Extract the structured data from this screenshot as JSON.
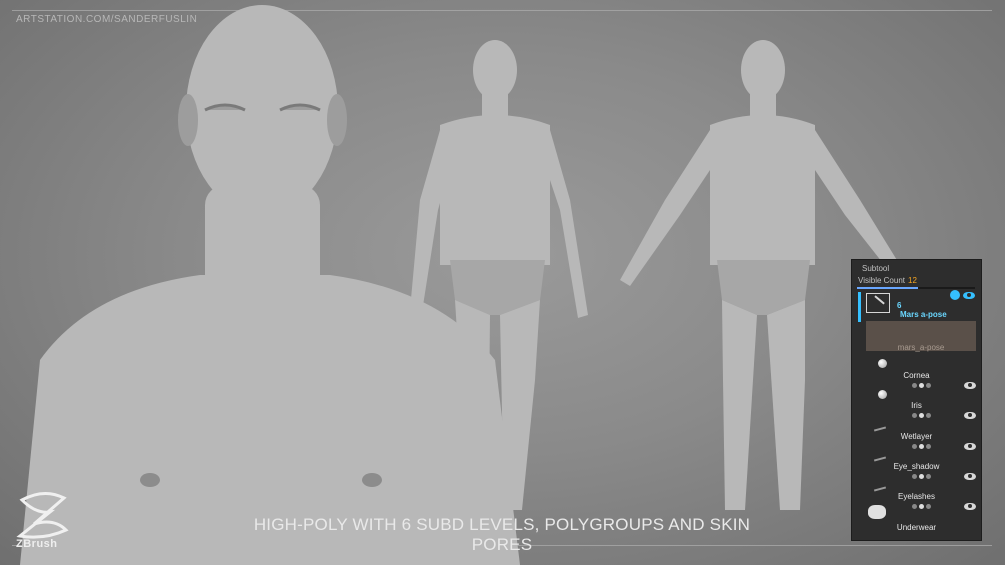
{
  "watermark": "ARTSTATION.COM/SANDERFUSLIN",
  "caption": "HIGH-POLY WITH 6 SUBD LEVELS, POLYGROUPS AND SKIN PORES",
  "logo_text": "ZBrush",
  "colors": {
    "accent": "#35c0ff",
    "count": "#f5a623",
    "panel_bg": "#2d2d2d"
  },
  "subtool": {
    "title": "Subtool",
    "visible_count_label": "Visible Count",
    "visible_count": "12",
    "active_number": "6",
    "active_name": "Mars a-pose",
    "selected_label": "mars_a-pose",
    "rows": [
      {
        "name": "Cornea"
      },
      {
        "name": "Iris"
      },
      {
        "name": "Wetlayer"
      },
      {
        "name": "Eye_shadow"
      },
      {
        "name": "Eyelashes"
      },
      {
        "name": "Underwear"
      }
    ]
  }
}
